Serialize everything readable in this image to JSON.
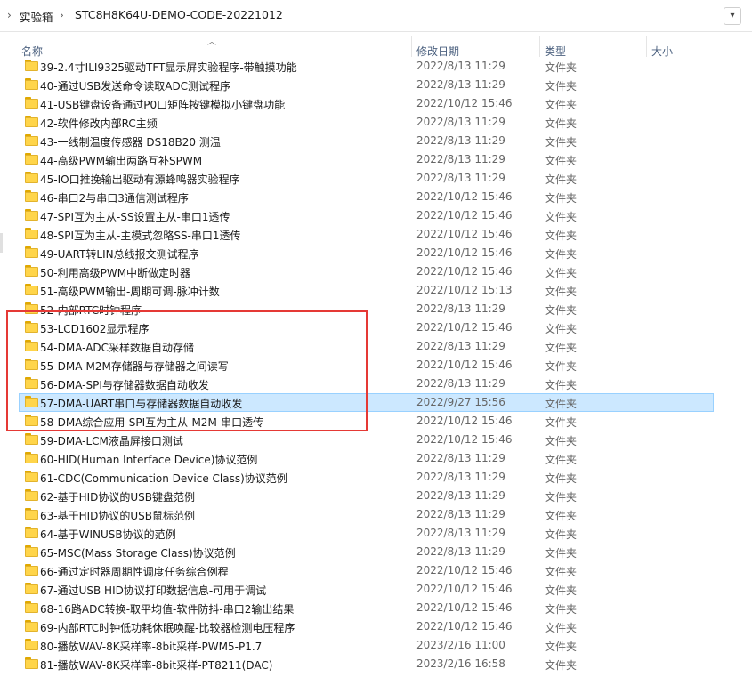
{
  "address_bar": {
    "crumb1": "实验箱",
    "crumb2": "STC8H8K64U-DEMO-CODE-20221012"
  },
  "columns": {
    "name": "名称",
    "date": "修改日期",
    "type": "类型",
    "size": "大小"
  },
  "rows": [
    {
      "name": "39-2.4寸ILI9325驱动TFT显示屏实验程序-带触摸功能",
      "date": "2022/8/13 11:29",
      "type": "文件夹"
    },
    {
      "name": "40-通过USB发送命令读取ADC测试程序",
      "date": "2022/8/13 11:29",
      "type": "文件夹"
    },
    {
      "name": "41-USB键盘设备通过P0口矩阵按键模拟小键盘功能",
      "date": "2022/10/12 15:46",
      "type": "文件夹"
    },
    {
      "name": "42-软件修改内部RC主频",
      "date": "2022/8/13 11:29",
      "type": "文件夹"
    },
    {
      "name": "43-一线制温度传感器 DS18B20 测温",
      "date": "2022/8/13 11:29",
      "type": "文件夹"
    },
    {
      "name": "44-高级PWM输出两路互补SPWM",
      "date": "2022/8/13 11:29",
      "type": "文件夹"
    },
    {
      "name": "45-IO口推挽输出驱动有源蜂鸣器实验程序",
      "date": "2022/8/13 11:29",
      "type": "文件夹"
    },
    {
      "name": "46-串口2与串口3通信测试程序",
      "date": "2022/10/12 15:46",
      "type": "文件夹"
    },
    {
      "name": "47-SPI互为主从-SS设置主从-串口1透传",
      "date": "2022/10/12 15:46",
      "type": "文件夹"
    },
    {
      "name": "48-SPI互为主从-主模式忽略SS-串口1透传",
      "date": "2022/10/12 15:46",
      "type": "文件夹"
    },
    {
      "name": "49-UART转LIN总线报文测试程序",
      "date": "2022/10/12 15:46",
      "type": "文件夹"
    },
    {
      "name": "50-利用高级PWM中断做定时器",
      "date": "2022/10/12 15:46",
      "type": "文件夹"
    },
    {
      "name": "51-高级PWM输出-周期可调-脉冲计数",
      "date": "2022/10/12 15:13",
      "type": "文件夹"
    },
    {
      "name": "52-内部RTC时钟程序",
      "date": "2022/8/13 11:29",
      "type": "文件夹"
    },
    {
      "name": "53-LCD1602显示程序",
      "date": "2022/10/12 15:46",
      "type": "文件夹"
    },
    {
      "name": "54-DMA-ADC采样数据自动存储",
      "date": "2022/8/13 11:29",
      "type": "文件夹"
    },
    {
      "name": "55-DMA-M2M存储器与存储器之间读写",
      "date": "2022/10/12 15:46",
      "type": "文件夹"
    },
    {
      "name": "56-DMA-SPI与存储器数据自动收发",
      "date": "2022/8/13 11:29",
      "type": "文件夹"
    },
    {
      "name": "57-DMA-UART串口与存储器数据自动收发",
      "date": "2022/9/27 15:56",
      "type": "文件夹"
    },
    {
      "name": "58-DMA综合应用-SPI互为主从-M2M-串口透传",
      "date": "2022/10/12 15:46",
      "type": "文件夹"
    },
    {
      "name": "59-DMA-LCM液晶屏接口测试",
      "date": "2022/10/12 15:46",
      "type": "文件夹"
    },
    {
      "name": "60-HID(Human Interface Device)协议范例",
      "date": "2022/8/13 11:29",
      "type": "文件夹"
    },
    {
      "name": "61-CDC(Communication Device Class)协议范例",
      "date": "2022/8/13 11:29",
      "type": "文件夹"
    },
    {
      "name": "62-基于HID协议的USB键盘范例",
      "date": "2022/8/13 11:29",
      "type": "文件夹"
    },
    {
      "name": "63-基于HID协议的USB鼠标范例",
      "date": "2022/8/13 11:29",
      "type": "文件夹"
    },
    {
      "name": "64-基于WINUSB协议的范例",
      "date": "2022/8/13 11:29",
      "type": "文件夹"
    },
    {
      "name": "65-MSC(Mass Storage Class)协议范例",
      "date": "2022/8/13 11:29",
      "type": "文件夹"
    },
    {
      "name": "66-通过定时器周期性调度任务综合例程",
      "date": "2022/10/12 15:46",
      "type": "文件夹"
    },
    {
      "name": "67-通过USB HID协议打印数据信息-可用于调试",
      "date": "2022/10/12 15:46",
      "type": "文件夹"
    },
    {
      "name": "68-16路ADC转换-取平均值-软件防抖-串口2输出结果",
      "date": "2022/10/12 15:46",
      "type": "文件夹"
    },
    {
      "name": "69-内部RTC时钟低功耗休眠唤醒-比较器检测电压程序",
      "date": "2022/10/12 15:46",
      "type": "文件夹"
    },
    {
      "name": "80-播放WAV-8K采样率-8bit采样-PWM5-P1.7",
      "date": "2023/2/16 11:00",
      "type": "文件夹"
    },
    {
      "name": "81-播放WAV-8K采样率-8bit采样-PT8211(DAC)",
      "date": "2023/2/16 16:58",
      "type": "文件夹"
    }
  ],
  "selected_index": 18
}
